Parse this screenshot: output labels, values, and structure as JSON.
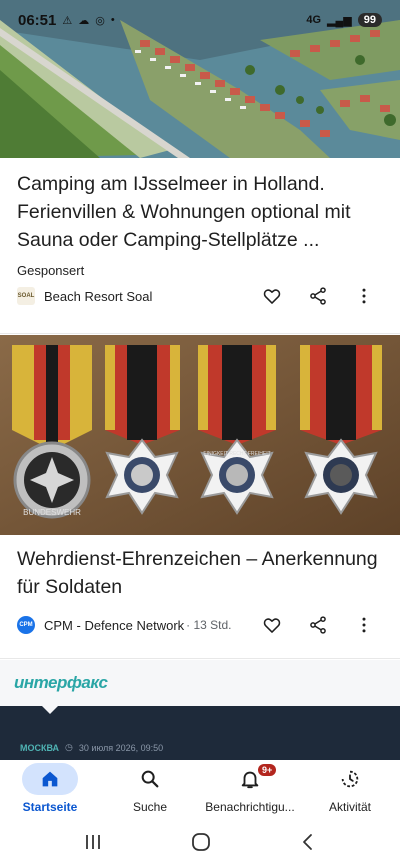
{
  "status_bar": {
    "time": "06:51",
    "network": "4G",
    "battery": "99"
  },
  "cards": [
    {
      "title": "Camping am IJsselmeer in Holland. Ferienvillen & Wohnungen optional mit Sauna oder Camping-Stellplätze ...",
      "sponsored_label": "Gesponsert",
      "source": "Beach Resort Soal",
      "source_logo_text": "SOAL"
    },
    {
      "title": "Wehrdienst-Ehrenzeichen – Anerkennung für Soldaten",
      "source": "CPM - Defence Network",
      "time": "· 13 Std.",
      "source_logo_text": "CPM",
      "image_text": {
        "medal_ring": "BUNDESWEHR",
        "cross_ring": "EINIGKEIT RECHT FREIHEIT"
      }
    },
    {
      "brand": "интерфакс",
      "location": "МОСКВА",
      "datetime": "30 июля 2026, 09:50"
    }
  ],
  "bottom_nav": [
    {
      "label": "Startseite",
      "icon": "home-icon",
      "active": true
    },
    {
      "label": "Suche",
      "icon": "search-icon",
      "active": false
    },
    {
      "label": "Benachrichtigu...",
      "icon": "bell-icon",
      "active": false,
      "badge": "9+"
    },
    {
      "label": "Aktivität",
      "icon": "activity-icon",
      "active": false
    }
  ],
  "colors": {
    "accent": "#0b57d0",
    "active_pill": "#d3e3fd",
    "badge": "#b3261e"
  }
}
